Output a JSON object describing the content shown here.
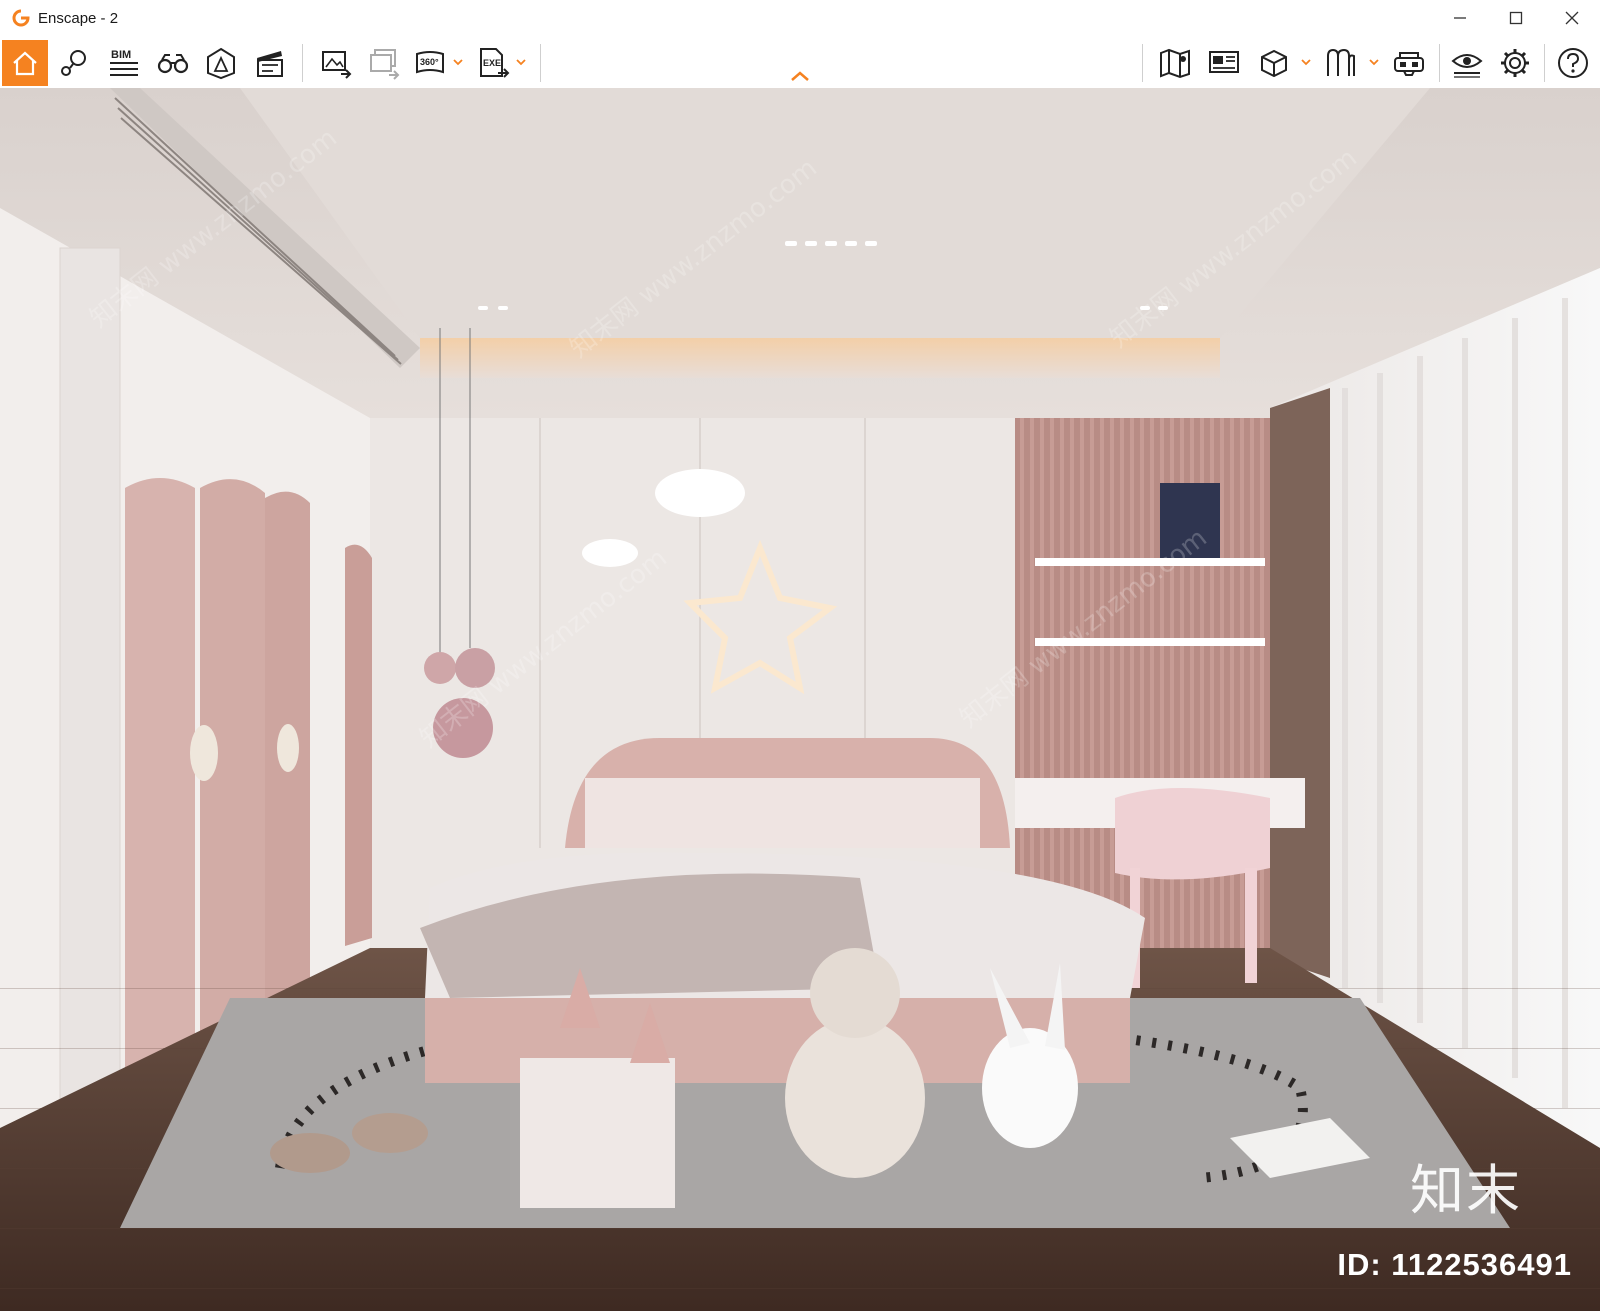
{
  "window": {
    "title": "Enscape - 2",
    "accent_color": "#f58220",
    "controls": [
      "minimize-icon",
      "maximize-icon",
      "close-icon"
    ]
  },
  "toolbar": {
    "left_tools": [
      {
        "name": "home",
        "icon": "home-icon",
        "active": true
      },
      {
        "name": "views",
        "icon": "location-pin-icon"
      },
      {
        "name": "bim",
        "icon": "bim-icon",
        "label": "BIM"
      },
      {
        "name": "binoculars",
        "icon": "binoculars-icon"
      },
      {
        "name": "asset-library",
        "icon": "asset-library-icon"
      },
      {
        "name": "video-editor",
        "icon": "clapperboard-icon"
      },
      {
        "name": "screenshot-export",
        "icon": "image-export-icon"
      },
      {
        "name": "batch-render",
        "icon": "batch-render-icon"
      },
      {
        "name": "panorama-360",
        "icon": "panorama-icon",
        "label": "360°",
        "dropdown": true
      },
      {
        "name": "exe-export",
        "icon": "exe-export-icon",
        "label": "EXE",
        "dropdown": true
      }
    ],
    "right_tools": [
      {
        "name": "map",
        "icon": "map-icon"
      },
      {
        "name": "presentation",
        "icon": "presentation-icon"
      },
      {
        "name": "cube-view",
        "icon": "cube-icon",
        "dropdown": true
      },
      {
        "name": "material-editor",
        "icon": "material-editor-icon",
        "dropdown": true
      },
      {
        "name": "vr-headset",
        "icon": "vr-headset-icon"
      },
      {
        "name": "visual-settings",
        "icon": "eye-icon"
      },
      {
        "name": "settings",
        "icon": "gear-icon"
      },
      {
        "name": "help",
        "icon": "help-icon"
      }
    ],
    "collapse_icon": "chevron-up-icon"
  },
  "viewport": {
    "scene": "kids-bedroom-render",
    "watermark_logo": "知末",
    "watermark_id": "ID: 1122536491",
    "diagonal_watermark": "知末网 www.znzmo.com"
  }
}
